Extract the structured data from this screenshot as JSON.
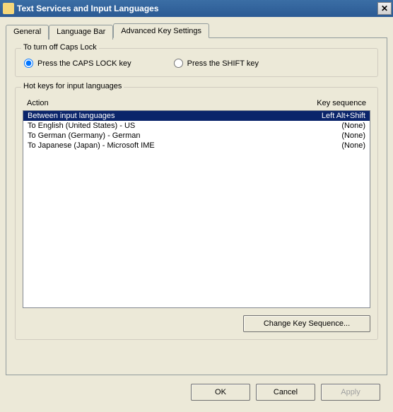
{
  "window": {
    "title": "Text Services and Input Languages"
  },
  "tabs": {
    "general": "General",
    "languageBar": "Language Bar",
    "advanced": "Advanced Key Settings"
  },
  "capsGroup": {
    "title": "To turn off Caps Lock",
    "optCaps": "Press the CAPS LOCK key",
    "optShift": "Press the SHIFT key"
  },
  "hotkeyGroup": {
    "title": "Hot keys for input languages",
    "colAction": "Action",
    "colKeySeq": "Key sequence",
    "rows": [
      {
        "action": "Between input languages",
        "keyseq": "Left Alt+Shift",
        "selected": true
      },
      {
        "action": "To English (United States) - US",
        "keyseq": "(None)",
        "selected": false
      },
      {
        "action": "To German (Germany) - German",
        "keyseq": "(None)",
        "selected": false
      },
      {
        "action": "To Japanese (Japan) - Microsoft IME",
        "keyseq": "(None)",
        "selected": false
      }
    ],
    "changeBtn": "Change Key Sequence..."
  },
  "buttons": {
    "ok": "OK",
    "cancel": "Cancel",
    "apply": "Apply"
  }
}
